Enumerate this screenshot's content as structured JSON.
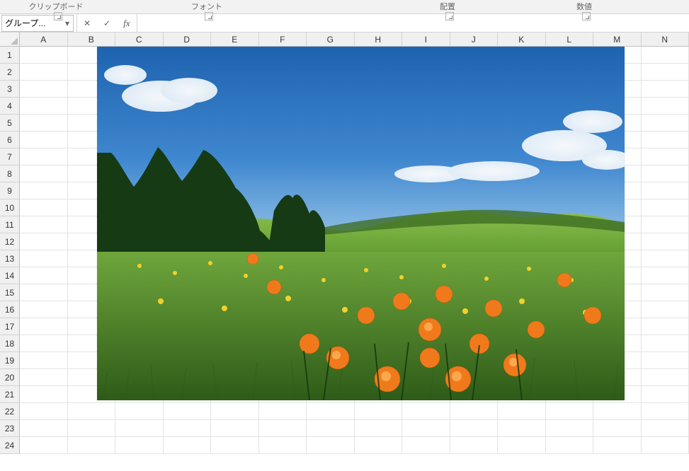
{
  "ribbon_groups": {
    "clipboard": {
      "label": "クリップボード"
    },
    "font": {
      "label": "フォント"
    },
    "align": {
      "label": "配置"
    },
    "number": {
      "label": "数値"
    }
  },
  "name_box": {
    "value": "グループ..."
  },
  "fx_buttons": {
    "cancel": "✕",
    "enter": "✓",
    "fx": "fx"
  },
  "formula": {
    "value": ""
  },
  "columns": [
    "A",
    "B",
    "C",
    "D",
    "E",
    "F",
    "G",
    "H",
    "I",
    "J",
    "K",
    "L",
    "M",
    "N"
  ],
  "rows": [
    "1",
    "2",
    "3",
    "4",
    "5",
    "6",
    "7",
    "8",
    "9",
    "10",
    "11",
    "12",
    "13",
    "14",
    "15",
    "16",
    "17",
    "18",
    "19",
    "20",
    "21",
    "22",
    "23",
    "24"
  ],
  "picture": {
    "alt": "meadow-photo"
  }
}
